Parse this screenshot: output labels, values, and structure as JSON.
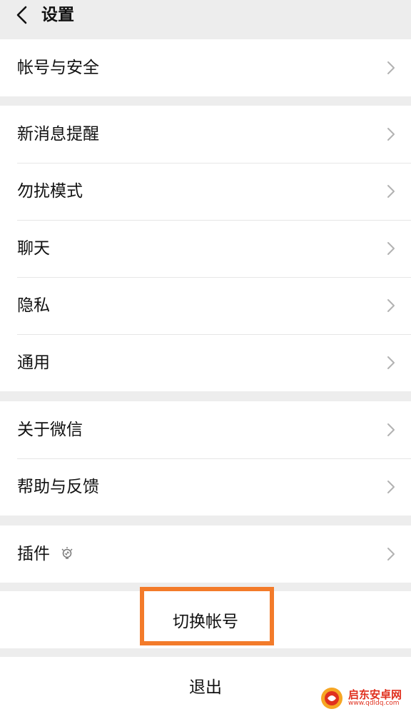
{
  "header": {
    "title": "设置",
    "back_icon": "chevron-left-icon"
  },
  "groups": [
    {
      "items": [
        {
          "label": "帐号与安全"
        }
      ]
    },
    {
      "items": [
        {
          "label": "新消息提醒"
        },
        {
          "label": "勿扰模式"
        },
        {
          "label": "聊天"
        },
        {
          "label": "隐私"
        },
        {
          "label": "通用"
        }
      ]
    },
    {
      "items": [
        {
          "label": "关于微信"
        },
        {
          "label": "帮助与反馈"
        }
      ]
    },
    {
      "items": [
        {
          "label": "插件",
          "badge_icon": "lightbulb-icon"
        }
      ]
    }
  ],
  "actions": {
    "switch_account": "切换帐号",
    "logout": "退出"
  },
  "highlight_color": "#f37b2a",
  "watermark": {
    "name": "启东安卓网",
    "url": "www.qdldq.com"
  }
}
